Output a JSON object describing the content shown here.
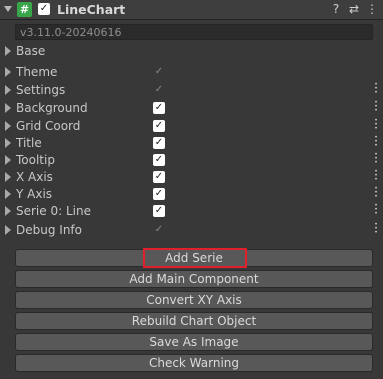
{
  "component": {
    "title": "LineChart",
    "script_icon": "#",
    "enabled_check": "✓",
    "icons": [
      "help-icon",
      "preset-icon",
      "context-menu-icon"
    ],
    "help_glyph": "?",
    "preset_glyph": "⇄",
    "menu_glyph": "⋮"
  },
  "version": "v3.11.0-20240616",
  "rows": [
    {
      "label": "Base",
      "check": null,
      "menu": false
    },
    {
      "label": "Theme",
      "check": "dim",
      "menu": false
    },
    {
      "label": "Settings",
      "check": "dim",
      "menu": true
    },
    {
      "label": "Background",
      "check": "on",
      "menu": true
    },
    {
      "label": "Grid Coord",
      "check": "on",
      "menu": true
    },
    {
      "label": "Title",
      "check": "on",
      "menu": true
    },
    {
      "label": "Tooltip",
      "check": "on",
      "menu": true
    },
    {
      "label": "X Axis",
      "check": "on",
      "menu": true
    },
    {
      "label": "Y Axis",
      "check": "on",
      "menu": true
    },
    {
      "label": "Serie 0: Line",
      "check": "on",
      "menu": true
    },
    {
      "label": "Debug Info",
      "check": "dim",
      "menu": true
    }
  ],
  "check_glyph": "✓",
  "buttons": [
    "Add Serie",
    "Add Main Component",
    "Convert XY Axis",
    "Rebuild Chart Object",
    "Save As Image",
    "Check Warning"
  ],
  "colors": {
    "background": "#383838",
    "script_icon": "#3aa64a",
    "button": "#585858",
    "highlight": "#e0202a"
  }
}
